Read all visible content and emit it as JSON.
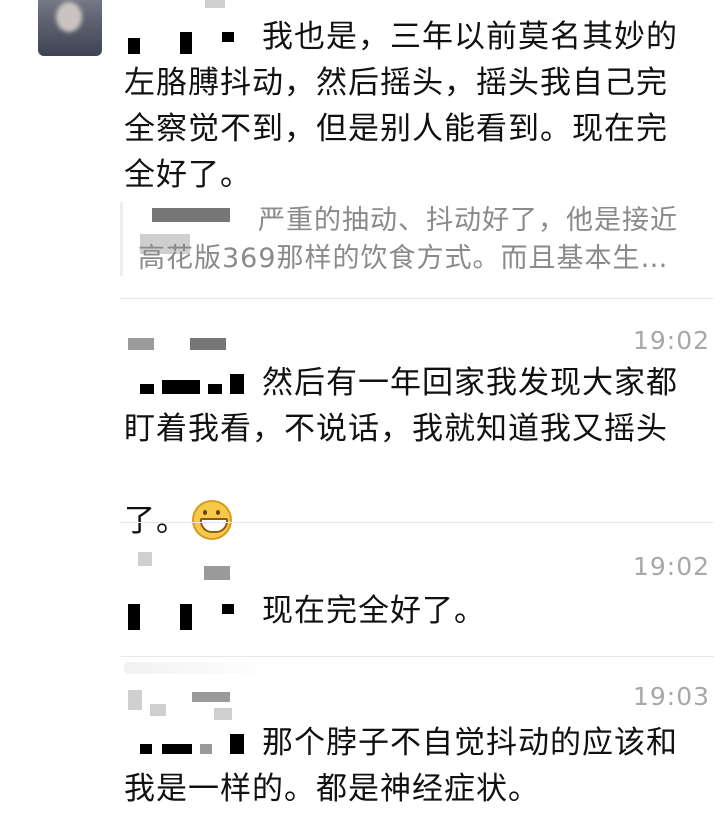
{
  "messages": [
    {
      "text": "我也是，三年以前莫名其妙的\n左胳膊抖动，然后摇头，摇头我自己完\n全察觉不到，但是别人能看到。现在完\n全好了。",
      "quote": "严重的抽动、抖动好了，他是接近\n高花版369那样的饮食方式。而且基本生…"
    },
    {
      "time": "19:02",
      "text": "然后有一年回家我发现大家都\n盯着我看，不说话，我就知道我又摇头\n了。",
      "emoji": "grinning-face"
    },
    {
      "time": "19:02",
      "text": "现在完全好了。"
    },
    {
      "time": "19:03",
      "text": "那个脖子不自觉抖动的应该和\n我是一样的。都是神经症状。"
    }
  ]
}
